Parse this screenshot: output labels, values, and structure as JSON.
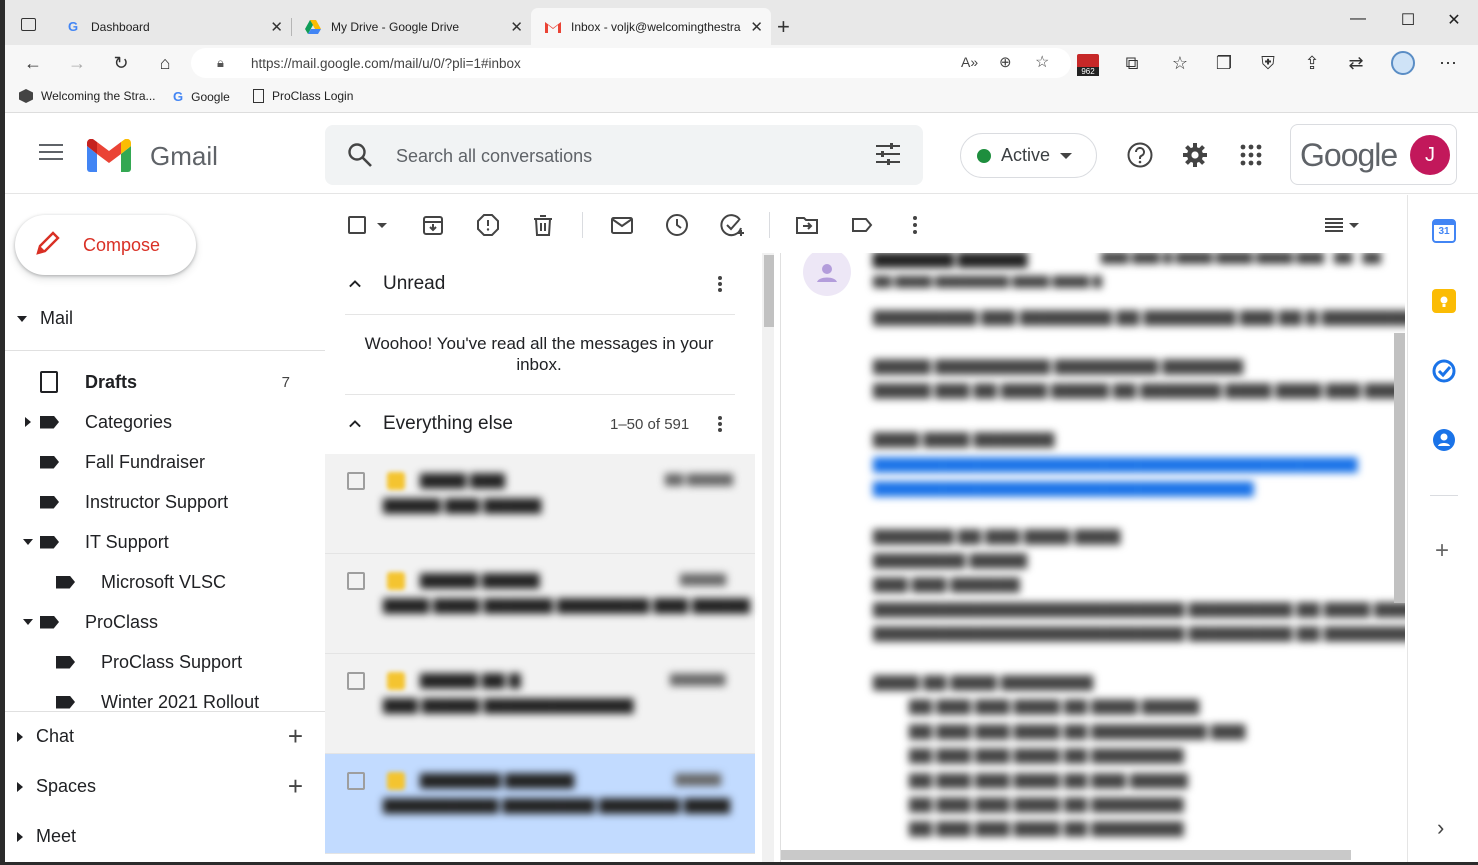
{
  "browser": {
    "tabs": [
      {
        "title": "Dashboard"
      },
      {
        "title": "My Drive - Google Drive"
      },
      {
        "title": "Inbox - voljk@welcomingthestra"
      }
    ],
    "url": "https://mail.google.com/mail/u/0/?pli=1#inbox",
    "extension_badge": "962",
    "bookmarks": [
      {
        "label": "Welcoming the Stra..."
      },
      {
        "label": "Google"
      },
      {
        "label": "ProClass Login"
      }
    ]
  },
  "gmail": {
    "product_name": "Gmail",
    "search_placeholder": "Search all conversations",
    "status": "Active",
    "account_brand": "Google",
    "avatar_initial": "J",
    "status_color": "#1e8e3e",
    "avatar_color": "#c2185b"
  },
  "sidebar": {
    "compose_label": "Compose",
    "mail_label": "Mail",
    "labels": [
      {
        "label": "Drafts",
        "count": "7",
        "bold": true
      },
      {
        "label": "Categories"
      },
      {
        "label": "Fall Fundraiser"
      },
      {
        "label": "Instructor Support"
      },
      {
        "label": "IT Support"
      },
      {
        "label": "Microsoft VLSC"
      },
      {
        "label": "ProClass"
      },
      {
        "label": "ProClass Support"
      },
      {
        "label": "Winter 2021 Rollout"
      }
    ],
    "chat_label": "Chat",
    "spaces_label": "Spaces",
    "meet_label": "Meet"
  },
  "list": {
    "unread_title": "Unread",
    "empty_message": "Woohoo! You've read all the messages in your inbox.",
    "everything_title": "Everything else",
    "range": "1–50 of 591"
  },
  "rail": {
    "calendar_day": "31"
  }
}
